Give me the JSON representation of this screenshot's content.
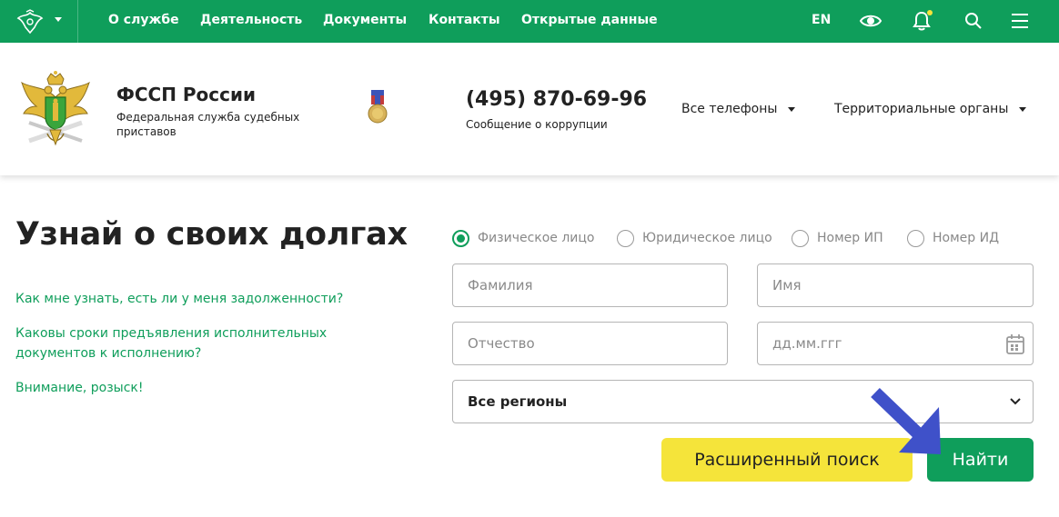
{
  "nav": {
    "items": [
      "О службе",
      "Деятельность",
      "Документы",
      "Контакты",
      "Открытые данные"
    ],
    "lang": "EN",
    "icons": [
      "eye-icon",
      "bell-icon",
      "search-icon",
      "menu-icon"
    ]
  },
  "header": {
    "org_name": "ФССП России",
    "org_subtitle": "Федеральная служба судебных приставов",
    "phone": "(495) 870-69-96",
    "phone_caption": "Сообщение о коррупции",
    "all_phones": "Все телефоны",
    "territorial": "Территориальные органы"
  },
  "main": {
    "title": "Узнай о своих долгах",
    "links": [
      "Как мне узнать, есть ли у меня задолженности?",
      "Каковы сроки предъявления исполнительных документов к исполнению?",
      "Внимание, розыск!"
    ]
  },
  "search": {
    "radios": [
      {
        "label": "Физическое лицо",
        "checked": true
      },
      {
        "label": "Юридическое лицо",
        "checked": false
      },
      {
        "label": "Номер ИП",
        "checked": false
      },
      {
        "label": "Номер ИД",
        "checked": false
      }
    ],
    "surname_placeholder": "Фамилия",
    "name_placeholder": "Имя",
    "patronymic_placeholder": "Отчество",
    "dob_placeholder": "дд.мм.ггг",
    "region_value": "Все регионы",
    "advanced_label": "Расширенный поиск",
    "find_label": "Найти"
  },
  "colors": {
    "brand_green": "#0f9e5b",
    "accent_yellow": "#f5e43a",
    "annotation_arrow": "#3f51c9"
  }
}
